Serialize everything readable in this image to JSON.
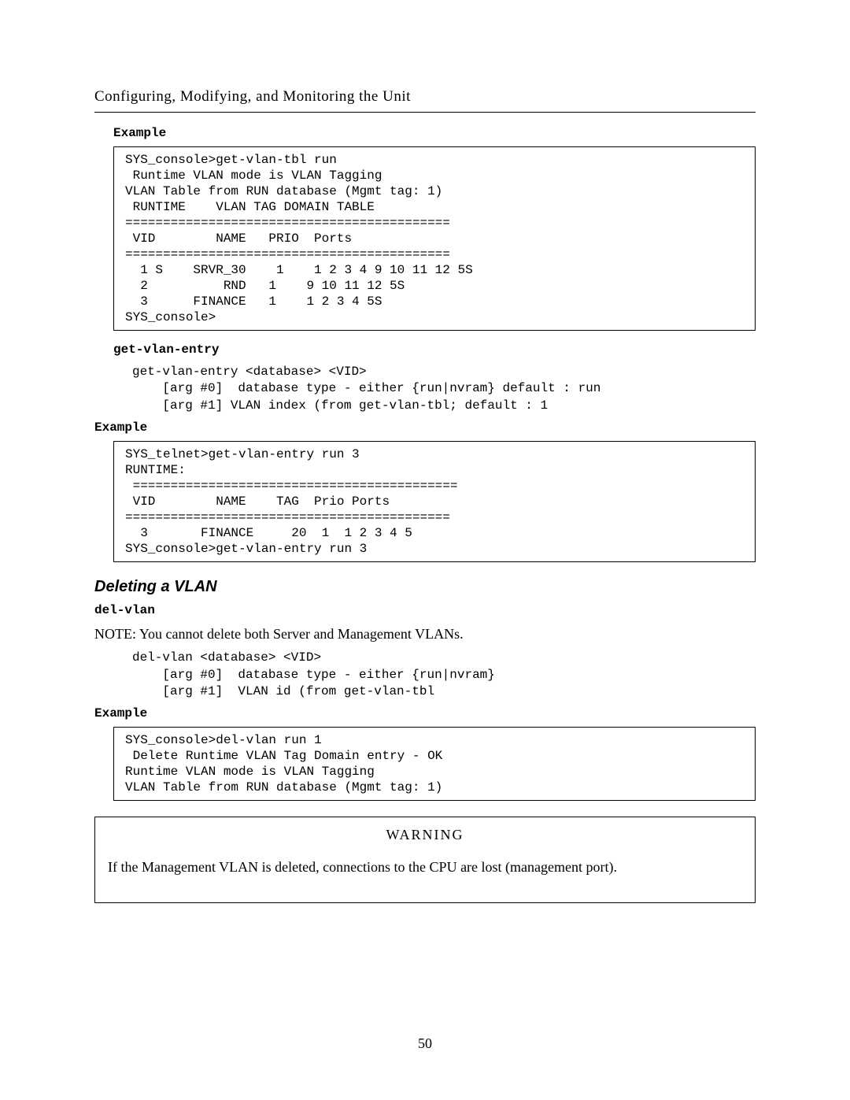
{
  "chapterTitle": "Configuring, Modifying, and Monitoring the Unit",
  "pageNumber": "50",
  "blocks": {
    "example1Label": "Example",
    "example1Code": "SYS_console>get-vlan-tbl run\n Runtime VLAN mode is VLAN Tagging\nVLAN Table from RUN database (Mgmt tag: 1)\n RUNTIME    VLAN TAG DOMAIN TABLE\n===========================================\n VID        NAME   PRIO  Ports\n===========================================\n  1 S    SRVR_30    1    1 2 3 4 9 10 11 12 5S\n  2          RND   1    9 10 11 12 5S\n  3      FINANCE   1    1 2 3 4 5S\nSYS_console>",
    "getVlanEntryLabel": "get-vlan-entry",
    "getVlanEntrySyntax": "get-vlan-entry <database> <VID>\n    [arg #0]  database type - either {run|nvram} default : run\n    [arg #1] VLAN index (from get-vlan-tbl; default : 1",
    "example2Label": "Example",
    "example2Code": "SYS_telnet>get-vlan-entry run 3\nRUNTIME:\n ===========================================\n VID        NAME    TAG  Prio Ports\n===========================================\n  3       FINANCE     20  1  1 2 3 4 5\nSYS_console>get-vlan-entry run 3",
    "deletingHeading": "Deleting a VLAN",
    "delVlanLabel": "del-vlan",
    "delNote": "NOTE: You cannot delete both Server and Management VLANs.",
    "delVlanSyntax": "del-vlan <database> <VID>\n    [arg #0]  database type - either {run|nvram}\n    [arg #1]  VLAN id (from get-vlan-tbl",
    "example3Label": "Example",
    "example3Code": "SYS_console>del-vlan run 1\n Delete Runtime VLAN Tag Domain entry - OK\nRuntime VLAN mode is VLAN Tagging\nVLAN Table from RUN database (Mgmt tag: 1)",
    "warningTitle": "WARNING",
    "warningBody": "If the Management VLAN is deleted, connections to the CPU are lost (management port)."
  }
}
